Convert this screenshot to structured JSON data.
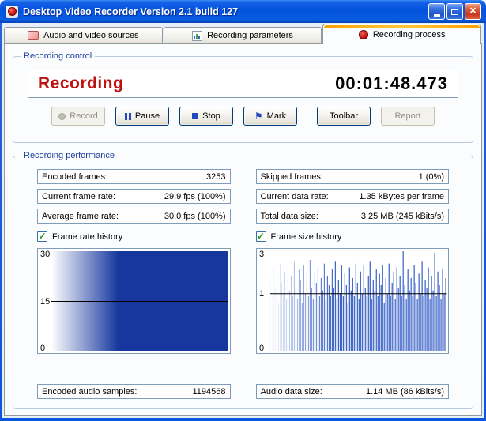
{
  "window": {
    "title": "Desktop Video Recorder Version 2.1 build 127"
  },
  "icons": {
    "app": "red-record-dot",
    "minimize": "minimize-bar",
    "maximize": "restore-square",
    "close": "✕",
    "tab_sources": "pink-screen",
    "tab_parameters": "mini-bar-chart",
    "tab_process": "red-record-dot",
    "record": "grey-circle",
    "pause": "blue-pause-bars",
    "stop": "blue-square",
    "mark": "⚑"
  },
  "colors": {
    "status_red": "#BE1212",
    "chart_navy": "#16379E",
    "chart_bar_blue": "#2450C0",
    "titlebar_blue": "#0353DD"
  },
  "tabs": [
    {
      "label": "Audio and video sources",
      "active": false
    },
    {
      "label": "Recording parameters",
      "active": false
    },
    {
      "label": "Recording process",
      "active": true
    }
  ],
  "recording_control": {
    "group_label": "Recording control",
    "status_text": "Recording",
    "timer": "00:01:48.473",
    "buttons": [
      {
        "label": "Record",
        "disabled": true
      },
      {
        "label": "Pause",
        "disabled": false
      },
      {
        "label": "Stop",
        "disabled": false
      },
      {
        "label": "Mark",
        "disabled": false
      },
      {
        "label": "Toolbar",
        "disabled": false
      },
      {
        "label": "Report",
        "disabled": true
      }
    ]
  },
  "recording_performance": {
    "group_label": "Recording performance",
    "left_fields": [
      {
        "label": "Encoded frames:",
        "value": "3253"
      },
      {
        "label": "Current frame rate:",
        "value": "29.9 fps (100%)"
      },
      {
        "label": "Average frame rate:",
        "value": "30.0 fps (100%)"
      }
    ],
    "right_fields": [
      {
        "label": "Skipped frames:",
        "value": "1 (0%)"
      },
      {
        "label": "Current data rate:",
        "value": "1.35 kBytes per frame"
      },
      {
        "label": "Total data size:",
        "value": "3.25 MB (245 kBits/s)"
      }
    ],
    "frame_rate_history": {
      "label": "Frame rate history",
      "checked": true
    },
    "frame_size_history": {
      "label": "Frame size history",
      "checked": true
    },
    "audio_left": {
      "label": "Encoded audio samples:",
      "value": "1194568"
    },
    "audio_right": {
      "label": "Audio data size:",
      "value": "1.14 MB (86 kBits/s)"
    }
  },
  "chart_data": [
    {
      "type": "area",
      "title": "Frame rate history",
      "ylim": [
        0,
        30
      ],
      "ticks": [
        30,
        15,
        0
      ],
      "gridline_at": 15,
      "y_scale": "linear",
      "constant_value": 30,
      "color": "#16379E",
      "fade_left": true,
      "legend": "off",
      "xlabel": "",
      "ylabel": ""
    },
    {
      "type": "bar",
      "title": "Frame size history",
      "ylim": [
        0,
        3
      ],
      "ticks": [
        3,
        1,
        0
      ],
      "gridline_at": 1,
      "y_scale": "sqrt",
      "color": "#2450C0",
      "fade_left": true,
      "legend": "off",
      "xlabel": "",
      "ylabel": "",
      "values": [
        1.6,
        0.9,
        2.1,
        1.2,
        1.8,
        0.7,
        2.3,
        1.4,
        1.0,
        1.9,
        0.8,
        2.2,
        1.1,
        1.7,
        0.9,
        2.4,
        1.3,
        0.8,
        2.0,
        1.5,
        0.7,
        2.2,
        1.0,
        1.8,
        0.9,
        2.5,
        1.2,
        0.8,
        1.9,
        1.4,
        2.1,
        0.9,
        1.6,
        1.1,
        2.3,
        0.8,
        1.7,
        1.3,
        0.9,
        2.0,
        1.2,
        2.4,
        0.8,
        1.5,
        1.0,
        2.2,
        0.9,
        1.8,
        1.3,
        0.7,
        2.1,
        1.1,
        1.6,
        0.9,
        2.3,
        1.4,
        0.8,
        1.9,
        1.0,
        2.2,
        1.2,
        0.9,
        1.7,
        2.4,
        0.8,
        1.5,
        1.1,
        2.0,
        0.9,
        1.8,
        1.3,
        2.2,
        0.7,
        1.6,
        1.0,
        2.3,
        0.9,
        1.4,
        1.9,
        0.8,
        2.1,
        1.2,
        1.7,
        0.9,
        3.0,
        1.3,
        0.8,
        2.0,
        1.1,
        1.6,
        0.9,
        2.2,
        1.4,
        0.8,
        1.8,
        1.0,
        2.4,
        0.9,
        1.5,
        1.2,
        2.1,
        0.8,
        1.7,
        1.1,
        2.9,
        0.9,
        1.9,
        1.3,
        0.8,
        2.0,
        1.0,
        1.6
      ]
    }
  ]
}
